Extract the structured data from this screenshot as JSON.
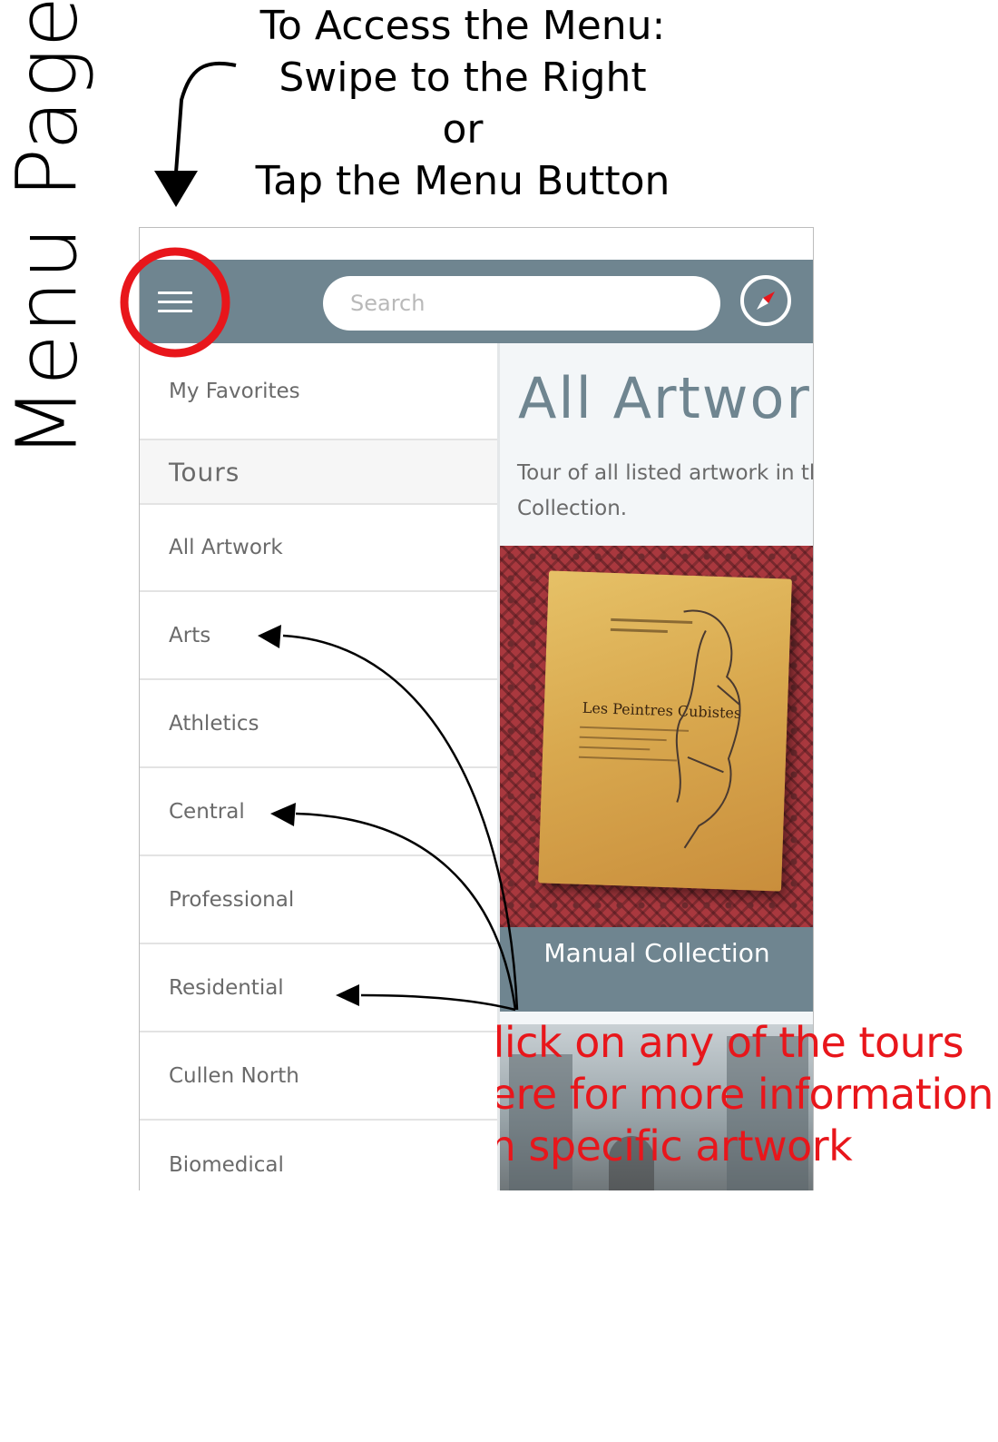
{
  "annotations": {
    "side_title": "Menu Page",
    "instructions": [
      "To Access the Menu:",
      "Swipe to the Right",
      "or",
      "Tap the Menu Button"
    ],
    "note_lines": [
      "Click on any of the tours",
      "here for more information",
      "on specific artwork"
    ],
    "note_color": "#e8161b",
    "highlight_color": "#e8161b"
  },
  "toolbar": {
    "menu_icon": "hamburger-menu-icon",
    "search_placeholder": "Search",
    "compass_icon": "compass-icon",
    "background": "#6f8590"
  },
  "menu": {
    "favorites_label": "My Favorites",
    "tours_header": "Tours",
    "items": [
      {
        "label": "All Artwork"
      },
      {
        "label": "Arts"
      },
      {
        "label": "Athletics"
      },
      {
        "label": "Central"
      },
      {
        "label": "Professional"
      },
      {
        "label": "Residential"
      },
      {
        "label": "Cullen North"
      },
      {
        "label": "Biomedical"
      }
    ]
  },
  "content": {
    "title": "All Artwork",
    "description": "Tour of all listed artwork in the Collection.",
    "card": {
      "book_title": "Les Peintres Cubistes",
      "caption": "Manual Collection"
    }
  }
}
